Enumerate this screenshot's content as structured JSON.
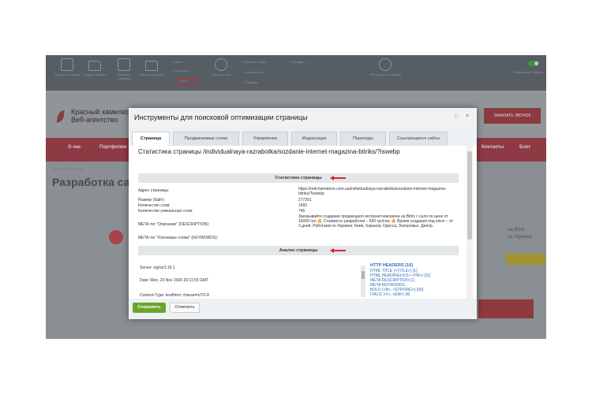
{
  "toolbar": {
    "buttons": [
      "Создать страницу",
      "Создать раздел",
      "Изменить страницу",
      "Изменить раздел",
      "Сбросить кеш",
      "Отладка"
    ],
    "small_items": [
      "Меню",
      "Структура",
      "SEO",
      "Шаблон сайта",
      "Компоненты",
      "Стикеры"
    ],
    "seo_label": "SEO",
    "right_label": "Режим правки Помощь",
    "center_label": "Обновите платформу"
  },
  "site": {
    "logo_line1": "Красный хамелеон",
    "logo_line2": "Веб-агентство",
    "order_button": "ЗАКАЗАТЬ ЗВОНОК",
    "nav": [
      "О нас",
      "Портфолио",
      "Контакты",
      "Блог"
    ],
    "crumbs": "Главная / Разработка",
    "page_title": "Разработка сайтов",
    "side_text_1": "на Bitrix",
    "side_text_2": "по Украине:"
  },
  "dialog": {
    "title": "Инструменты для поисковой оптимизации страницы",
    "tabs": [
      "Страница",
      "Продвигаемые слова",
      "Управление",
      "Индексация",
      "Переходы",
      "Ссылающиеся сайты"
    ],
    "stats_title": "Статистика страницы /individualnaya-razrabotka/sozdanie-internet-magazina-bitriks/?iswebp",
    "section_stats": "Статистика страницы",
    "section_analysis": "Анализ страницы",
    "fields": [
      {
        "label": "Адрес страницы:",
        "value": "https://redchameleon.com.ua/individualnaya-razrabotka/sozdanie-internet-magazina-bitriks/?iswebp"
      },
      {
        "label": "Размер (байт):",
        "value": "277261"
      },
      {
        "label": "Количество слов:",
        "value": "1660"
      },
      {
        "label": "Количество уникальных слов:",
        "value": "745"
      },
      {
        "label": "META-тег \"Описание\" (DESCRIPTION):",
        "value": "Заказывайте создание продающего интернет-магазина на Bitrix с нуля по цене от 16000 грн 🔥 Стоимость разработки – 650 грн/час 🔥 Время создания под ключ – от 3 дней. Работаем по Украине: Киев, Харьков, Одесса, Запорожье, Днепр."
      },
      {
        "label": "META-тег \"Ключевые слова\" (KEYWORDS):",
        "value": ""
      }
    ],
    "analysis_lines": [
      "Server: nginx/1.16.1",
      "Date: Mon, 23 Nov 2020 20:11:55 GMT",
      "Content-Type: text/html; charset=UTF-8"
    ],
    "headers_list": [
      "HTTP HEADERS [16]",
      "HTML TITLE (<TITLE>) [1]",
      "HTML HEADING(<H1>-<H6>) [11]",
      "META DESCRIPTION [1]",
      "META KEYWORDS",
      "BOLD (<B>, <STRONG>) [30]",
      "ITALIC (<I>, <EM>) [4]"
    ],
    "save_button": "Сохранить",
    "cancel_button": "Отменить"
  },
  "colors": {
    "annotation_red": "#d7262b",
    "save_green": "#6aa52a",
    "link_blue": "#2a6ebd"
  }
}
